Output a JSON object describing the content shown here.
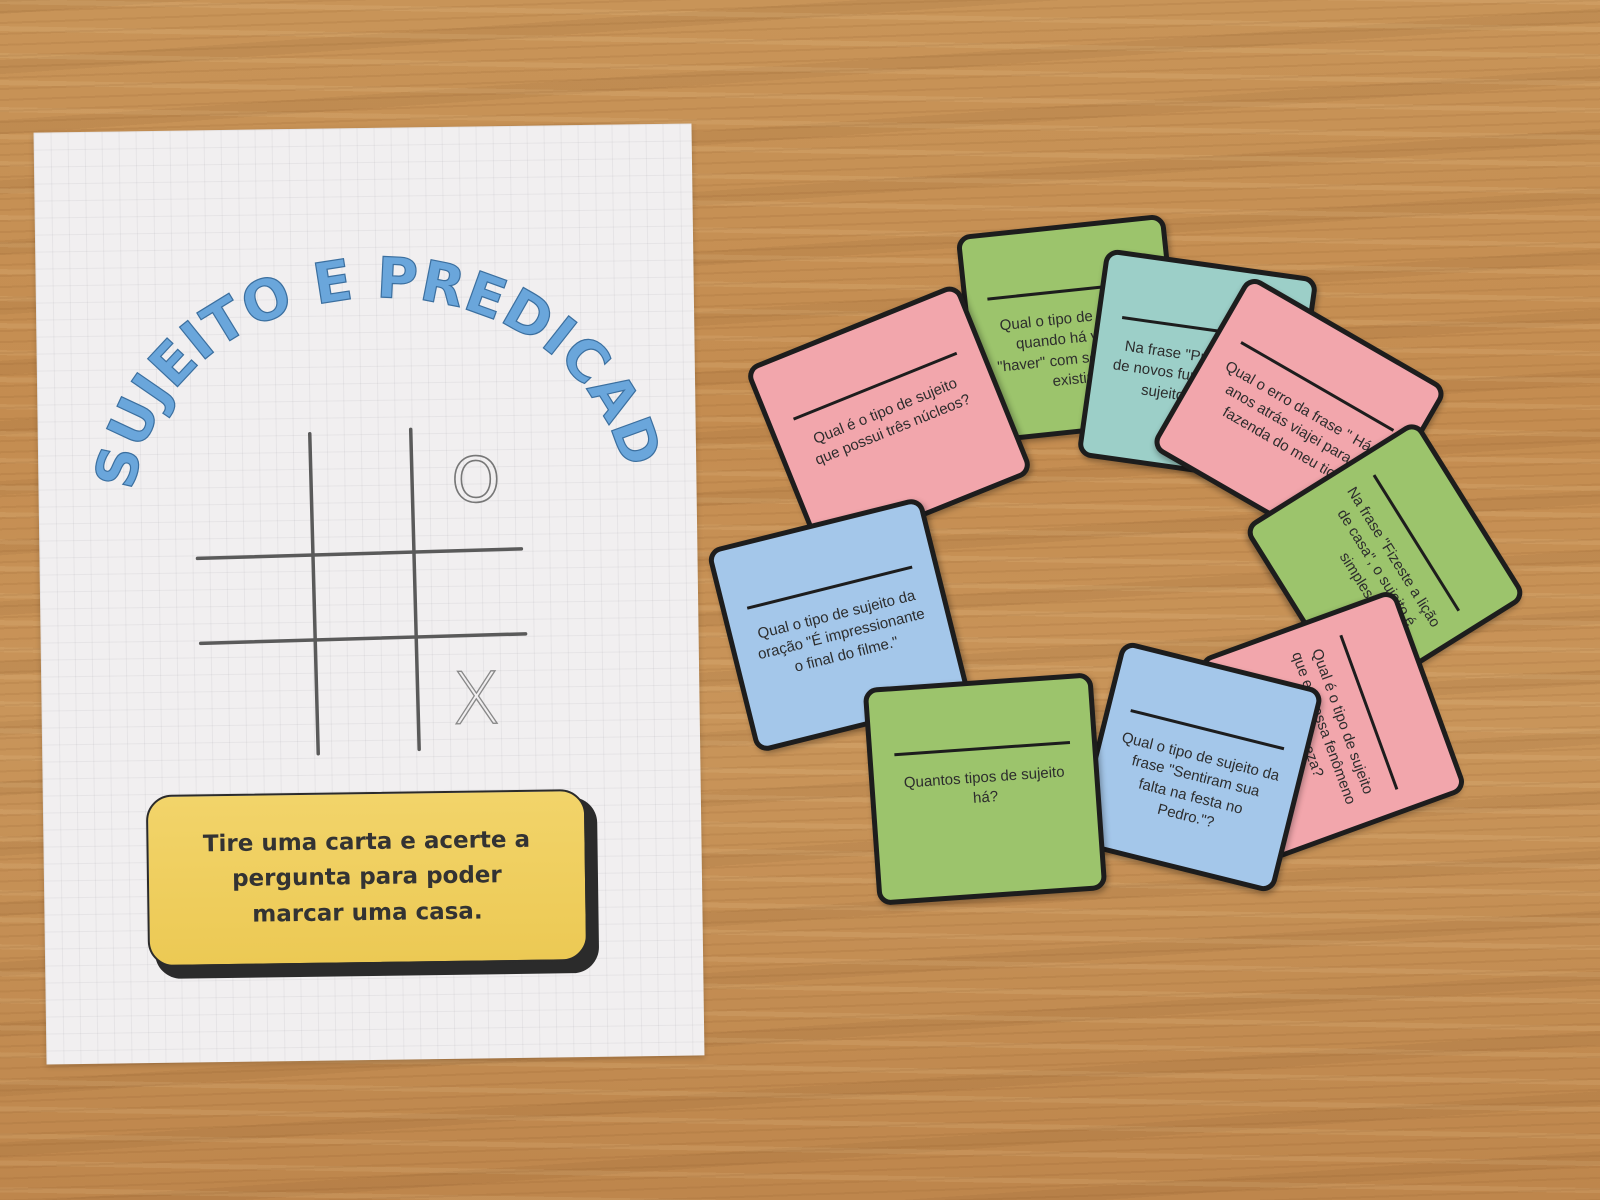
{
  "sheet": {
    "title": "SUJEITO E PREDICADO",
    "marks": {
      "o": "O",
      "x": "X"
    },
    "instruction": "Tire uma carta e acerte a pergunta para poder marcar uma casa."
  },
  "cards": [
    {
      "color": "#9cc46c",
      "text": "Qual o tipo de sujeito quando há verbo \"haver\" com sentido de existir?"
    },
    {
      "color": "#9ccfc8",
      "text": "Na frase \"Precisam-se de novos funcionários\", o sujeito é do tipo"
    },
    {
      "color": "#f2a6ac",
      "text": "Qual é o tipo de sujeito que possui três núcleos?"
    },
    {
      "color": "#f2a6ac",
      "text": "Qual o erro da frase \" Há 2 anos atrás viajei para a fazenda do meu tio.\""
    },
    {
      "color": "#9cc46c",
      "text": "Na frase \"Fizeste a lição de casa\", o sujeito é simples?"
    },
    {
      "color": "#a4c7ea",
      "text": "Qual o tipo de sujeito da oração \"É impressionante o final do filme.\""
    },
    {
      "color": "#f2a6ac",
      "text": "Qual é o tipo de sujeito que expressa fenômeno da natureza?"
    },
    {
      "color": "#a4c7ea",
      "text": "Qual o tipo de sujeito da frase \"Sentiram sua falta na festa no Pedro.\"?"
    },
    {
      "color": "#9cc46c",
      "text": "Quantos tipos de sujeito há?"
    }
  ]
}
